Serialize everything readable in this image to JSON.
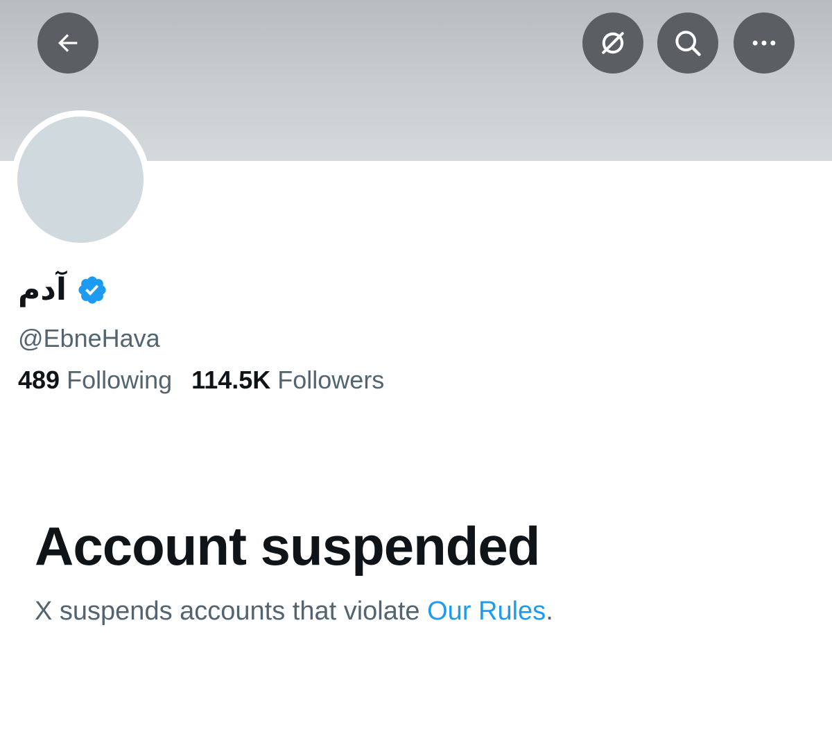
{
  "header": {
    "back_icon": "arrow-left-icon",
    "translate_icon": "no-translate-icon",
    "search_icon": "search-icon",
    "more_icon": "more-dots-icon"
  },
  "profile": {
    "display_name": "آدم",
    "handle": "@EbneHava",
    "verified_icon": "verified-badge-icon",
    "verified_color": "#1d9bf0",
    "following_count": "489",
    "following_label": "Following",
    "followers_count": "114.5K",
    "followers_label": "Followers"
  },
  "suspension": {
    "title": "Account suspended",
    "description_prefix": "X suspends accounts that violate ",
    "rules_link": "Our Rules",
    "description_suffix": "."
  },
  "colors": {
    "text_primary": "#0f1419",
    "text_secondary": "#536471",
    "link": "#1d9bf0",
    "button_bg": "#5b5f63"
  }
}
